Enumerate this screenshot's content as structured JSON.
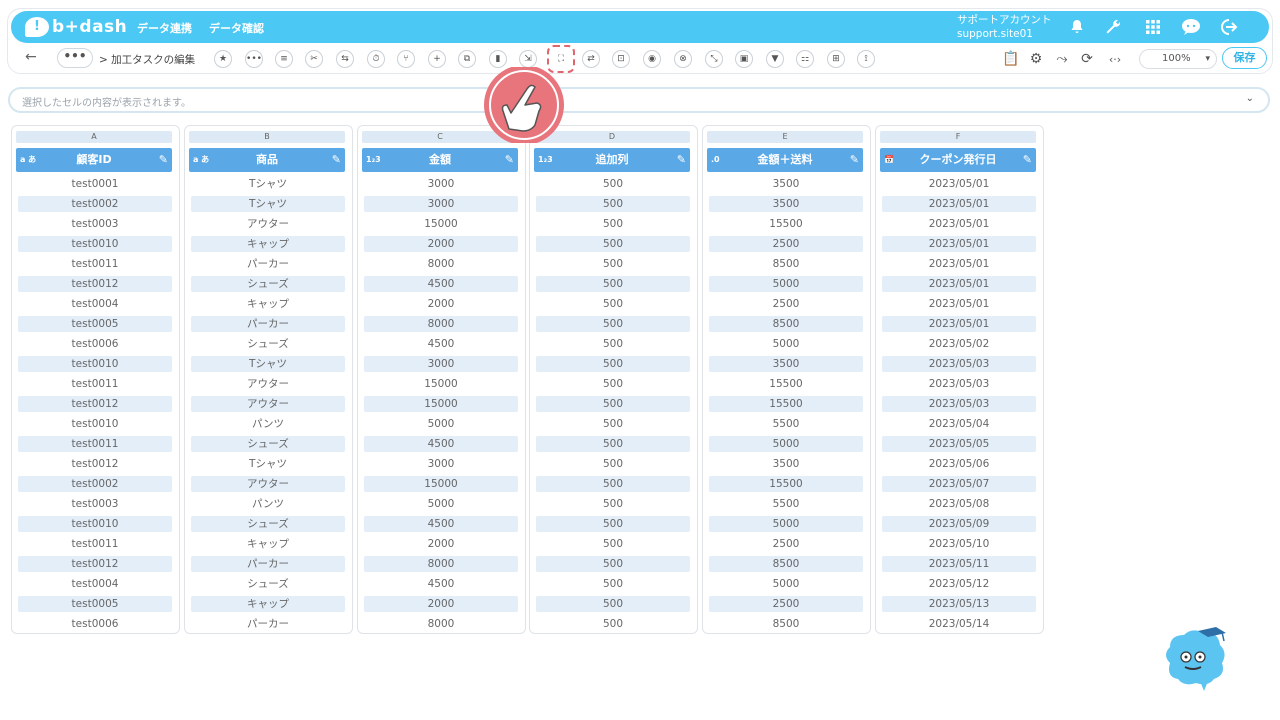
{
  "header": {
    "logo_mark": "!",
    "logo_text": "b+dash",
    "nav": [
      "データ連携",
      "データ確認"
    ],
    "account_name": "サポートアカウント",
    "account_id": "support.site01",
    "icons": [
      "bell-icon",
      "wrench-icon",
      "grid-icon",
      "chat-icon",
      "logout-icon"
    ]
  },
  "toolbar": {
    "back": "←",
    "more": "•••",
    "breadcrumb": "> 加工タスクの編集",
    "tools": [
      "★",
      "•••",
      "≡",
      "✂",
      "⇆",
      "⏱",
      "⑂",
      "+",
      "⧉",
      "▮",
      "⇲",
      "⛶",
      "⇄",
      "⊡",
      "◉",
      "⊗",
      "⤡",
      "▣",
      "▼",
      "⚏",
      "⊞",
      "⟟"
    ],
    "right_icons": [
      "📋",
      "⚙",
      "⤳",
      "⟳",
      "‹·›"
    ],
    "zoom": "100%",
    "save": "保存"
  },
  "cellbar": {
    "placeholder": "選択したセルの内容が表示されます。",
    "chevron": "⌄"
  },
  "columns": [
    {
      "letter": "A",
      "type": "a あ",
      "name": "顧客ID",
      "cells": [
        "test0001",
        "test0002",
        "test0003",
        "test0010",
        "test0011",
        "test0012",
        "test0004",
        "test0005",
        "test0006",
        "test0010",
        "test0011",
        "test0012",
        "test0010",
        "test0011",
        "test0012",
        "test0002",
        "test0003",
        "test0010",
        "test0011",
        "test0012",
        "test0004",
        "test0005",
        "test0006"
      ]
    },
    {
      "letter": "B",
      "type": "a あ",
      "name": "商品",
      "cells": [
        "Tシャツ",
        "Tシャツ",
        "アウター",
        "キャップ",
        "パーカー",
        "シューズ",
        "キャップ",
        "パーカー",
        "シューズ",
        "Tシャツ",
        "アウター",
        "アウター",
        "パンツ",
        "シューズ",
        "Tシャツ",
        "アウター",
        "パンツ",
        "シューズ",
        "キャップ",
        "パーカー",
        "シューズ",
        "キャップ",
        "パーカー"
      ]
    },
    {
      "letter": "C",
      "type": "1₂3",
      "name": "金額",
      "cells": [
        "3000",
        "3000",
        "15000",
        "2000",
        "8000",
        "4500",
        "2000",
        "8000",
        "4500",
        "3000",
        "15000",
        "15000",
        "5000",
        "4500",
        "3000",
        "15000",
        "5000",
        "4500",
        "2000",
        "8000",
        "4500",
        "2000",
        "8000"
      ]
    },
    {
      "letter": "D",
      "type": "1₂3",
      "name": "追加列",
      "cells": [
        "500",
        "500",
        "500",
        "500",
        "500",
        "500",
        "500",
        "500",
        "500",
        "500",
        "500",
        "500",
        "500",
        "500",
        "500",
        "500",
        "500",
        "500",
        "500",
        "500",
        "500",
        "500",
        "500"
      ]
    },
    {
      "letter": "E",
      "type": ".0",
      "name": "金額＋送料",
      "cells": [
        "3500",
        "3500",
        "15500",
        "2500",
        "8500",
        "5000",
        "2500",
        "8500",
        "5000",
        "3500",
        "15500",
        "15500",
        "5500",
        "5000",
        "3500",
        "15500",
        "5500",
        "5000",
        "2500",
        "8500",
        "5000",
        "2500",
        "8500"
      ]
    },
    {
      "letter": "F",
      "type": "📅",
      "name": "クーポン発行日",
      "cells": [
        "2023/05/01",
        "2023/05/01",
        "2023/05/01",
        "2023/05/01",
        "2023/05/01",
        "2023/05/01",
        "2023/05/01",
        "2023/05/01",
        "2023/05/02",
        "2023/05/03",
        "2023/05/03",
        "2023/05/03",
        "2023/05/04",
        "2023/05/05",
        "2023/05/06",
        "2023/05/07",
        "2023/05/08",
        "2023/05/09",
        "2023/05/10",
        "2023/05/11",
        "2023/05/12",
        "2023/05/13",
        "2023/05/14"
      ]
    }
  ]
}
